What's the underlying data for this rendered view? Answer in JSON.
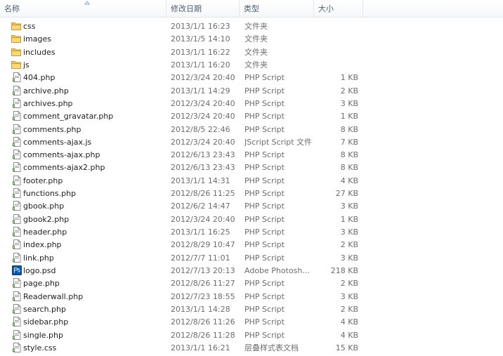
{
  "columns": {
    "name": "名称",
    "date": "修改日期",
    "type": "类型",
    "size": "大小"
  },
  "colors": {
    "header_text": "#4c607a",
    "meta_text": "#6d6d6d",
    "folder": "#e8b43c",
    "script_icon": "#3a8a2a",
    "psd_icon": "#0b56a8"
  },
  "files": [
    {
      "name": "css",
      "date": "2013/1/1 16:23",
      "type": "文件夹",
      "size": "",
      "icon": "folder-icon"
    },
    {
      "name": "images",
      "date": "2013/1/5 14:10",
      "type": "文件夹",
      "size": "",
      "icon": "folder-icon"
    },
    {
      "name": "includes",
      "date": "2013/1/1 16:22",
      "type": "文件夹",
      "size": "",
      "icon": "folder-icon"
    },
    {
      "name": "js",
      "date": "2013/1/1 16:20",
      "type": "文件夹",
      "size": "",
      "icon": "folder-icon"
    },
    {
      "name": "404.php",
      "date": "2012/3/24 20:40",
      "type": "PHP Script",
      "size": "1 KB",
      "icon": "script-file-icon"
    },
    {
      "name": "archive.php",
      "date": "2013/1/1 14:29",
      "type": "PHP Script",
      "size": "2 KB",
      "icon": "script-file-icon"
    },
    {
      "name": "archives.php",
      "date": "2012/3/24 20:40",
      "type": "PHP Script",
      "size": "3 KB",
      "icon": "script-file-icon"
    },
    {
      "name": "comment_gravatar.php",
      "date": "2012/3/24 20:40",
      "type": "PHP Script",
      "size": "1 KB",
      "icon": "script-file-icon"
    },
    {
      "name": "comments.php",
      "date": "2012/8/5 22:46",
      "type": "PHP Script",
      "size": "8 KB",
      "icon": "script-file-icon"
    },
    {
      "name": "comments-ajax.js",
      "date": "2012/3/24 20:40",
      "type": "JScript Script 文件",
      "size": "7 KB",
      "icon": "script-file-icon"
    },
    {
      "name": "comments-ajax.php",
      "date": "2012/6/13 23:43",
      "type": "PHP Script",
      "size": "8 KB",
      "icon": "script-file-icon"
    },
    {
      "name": "comments-ajax2.php",
      "date": "2012/6/13 23:43",
      "type": "PHP Script",
      "size": "8 KB",
      "icon": "script-file-icon"
    },
    {
      "name": "footer.php",
      "date": "2013/1/1 14:31",
      "type": "PHP Script",
      "size": "4 KB",
      "icon": "script-file-icon"
    },
    {
      "name": "functions.php",
      "date": "2012/8/26 11:25",
      "type": "PHP Script",
      "size": "27 KB",
      "icon": "script-file-icon"
    },
    {
      "name": "gbook.php",
      "date": "2012/6/2 14:47",
      "type": "PHP Script",
      "size": "3 KB",
      "icon": "script-file-icon"
    },
    {
      "name": "gbook2.php",
      "date": "2012/3/24 20:40",
      "type": "PHP Script",
      "size": "1 KB",
      "icon": "script-file-icon"
    },
    {
      "name": "header.php",
      "date": "2013/1/1 16:25",
      "type": "PHP Script",
      "size": "3 KB",
      "icon": "script-file-icon"
    },
    {
      "name": "index.php",
      "date": "2012/8/29 10:47",
      "type": "PHP Script",
      "size": "2 KB",
      "icon": "script-file-icon"
    },
    {
      "name": "link.php",
      "date": "2012/7/7 11:01",
      "type": "PHP Script",
      "size": "3 KB",
      "icon": "script-file-icon"
    },
    {
      "name": "logo.psd",
      "date": "2012/7/13 20:13",
      "type": "Adobe Photosh...",
      "size": "218 KB",
      "icon": "photoshop-file-icon"
    },
    {
      "name": "page.php",
      "date": "2012/8/26 11:27",
      "type": "PHP Script",
      "size": "2 KB",
      "icon": "script-file-icon"
    },
    {
      "name": "Readerwall.php",
      "date": "2012/7/23 18:55",
      "type": "PHP Script",
      "size": "3 KB",
      "icon": "script-file-icon"
    },
    {
      "name": "search.php",
      "date": "2013/1/1 14:28",
      "type": "PHP Script",
      "size": "2 KB",
      "icon": "script-file-icon"
    },
    {
      "name": "sidebar.php",
      "date": "2012/8/26 11:26",
      "type": "PHP Script",
      "size": "4 KB",
      "icon": "script-file-icon"
    },
    {
      "name": "single.php",
      "date": "2012/8/26 11:28",
      "type": "PHP Script",
      "size": "4 KB",
      "icon": "script-file-icon"
    },
    {
      "name": "style.css",
      "date": "2013/1/1 16:21",
      "type": "层叠样式表文档",
      "size": "15 KB",
      "icon": "script-file-icon"
    }
  ]
}
